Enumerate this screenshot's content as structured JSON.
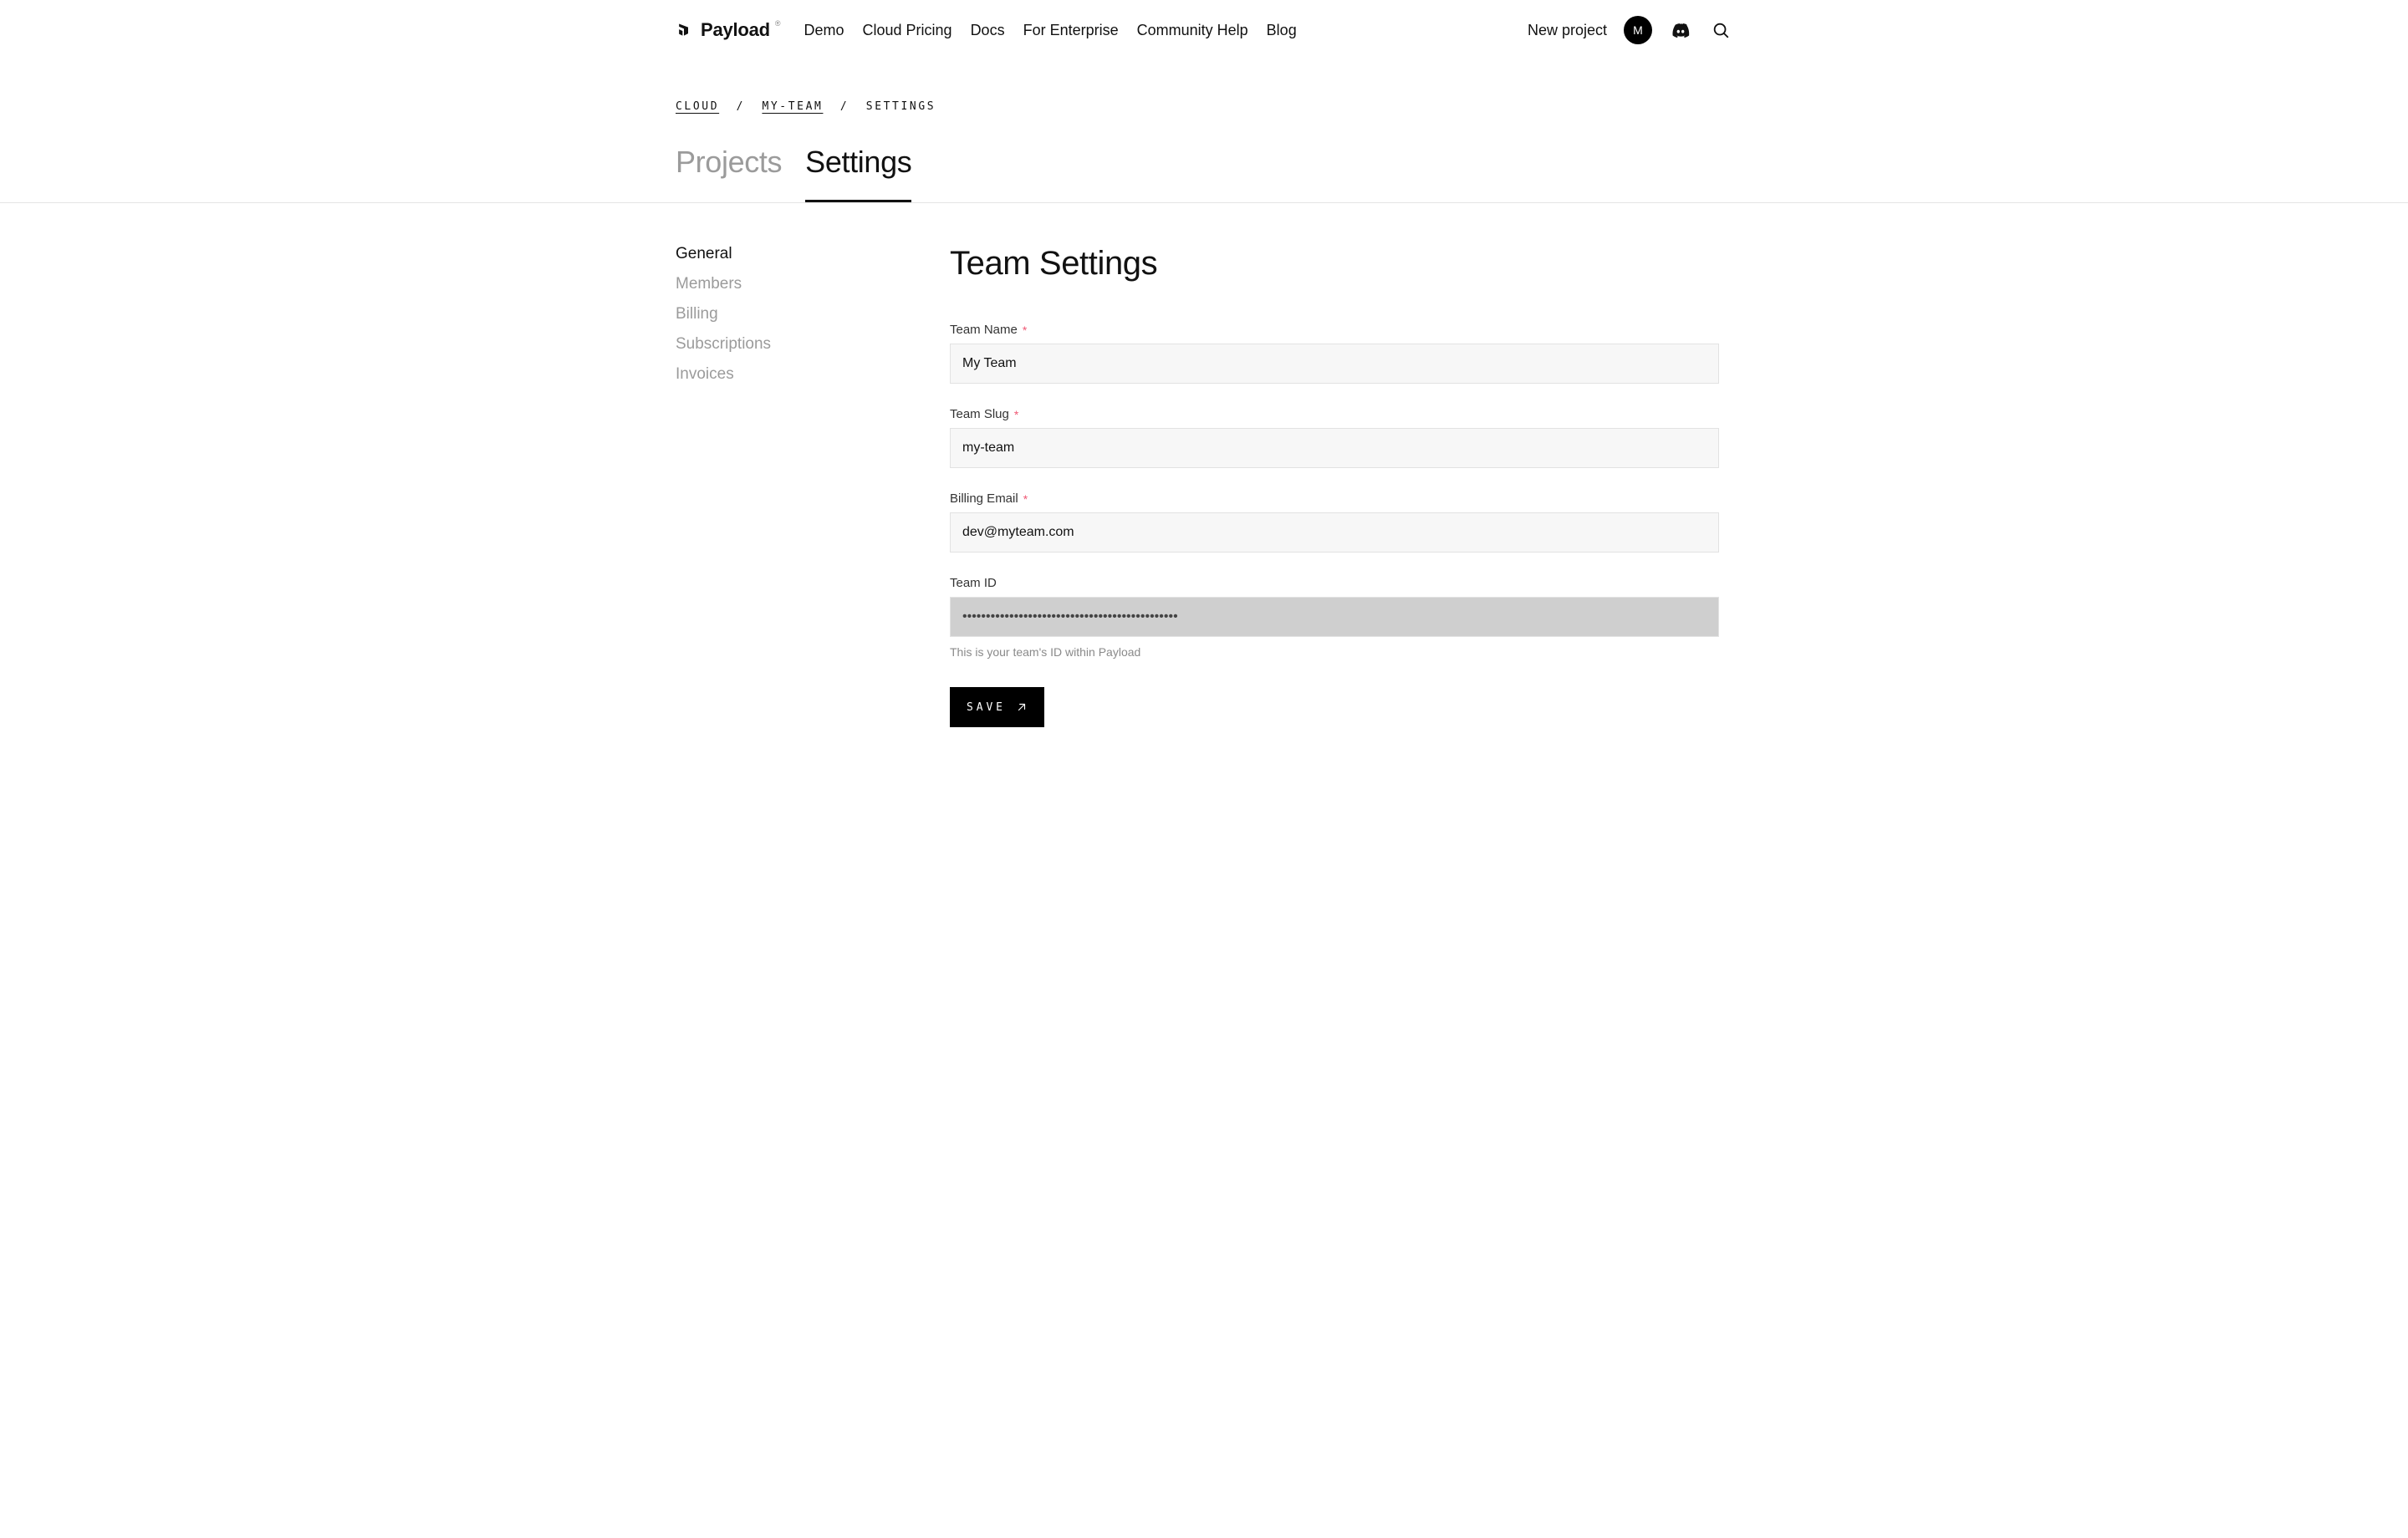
{
  "brand": {
    "name": "Payload"
  },
  "nav": {
    "items": [
      {
        "label": "Demo"
      },
      {
        "label": "Cloud Pricing"
      },
      {
        "label": "Docs"
      },
      {
        "label": "For Enterprise"
      },
      {
        "label": "Community Help"
      },
      {
        "label": "Blog"
      }
    ],
    "new_project": "New project",
    "avatar_initial": "M"
  },
  "breadcrumb": {
    "items": [
      {
        "label": "CLOUD",
        "link": true
      },
      {
        "label": "MY-TEAM",
        "link": true
      },
      {
        "label": "SETTINGS",
        "link": false
      }
    ],
    "separator": "/"
  },
  "tabs": {
    "items": [
      {
        "label": "Projects",
        "active": false
      },
      {
        "label": "Settings",
        "active": true
      }
    ]
  },
  "sidenav": {
    "items": [
      {
        "label": "General",
        "active": true
      },
      {
        "label": "Members",
        "active": false
      },
      {
        "label": "Billing",
        "active": false
      },
      {
        "label": "Subscriptions",
        "active": false
      },
      {
        "label": "Invoices",
        "active": false
      }
    ]
  },
  "page": {
    "title": "Team Settings"
  },
  "form": {
    "team_name": {
      "label": "Team Name",
      "value": "My Team",
      "required": true
    },
    "team_slug": {
      "label": "Team Slug",
      "value": "my-team",
      "required": true
    },
    "billing_email": {
      "label": "Billing Email",
      "value": "dev@myteam.com",
      "required": true
    },
    "team_id": {
      "label": "Team ID",
      "value": "••••••••••••••••••••••••••••••••••••••••••••••",
      "hint": "This is your team's ID within Payload",
      "required": false
    },
    "save_label": "SAVE"
  }
}
